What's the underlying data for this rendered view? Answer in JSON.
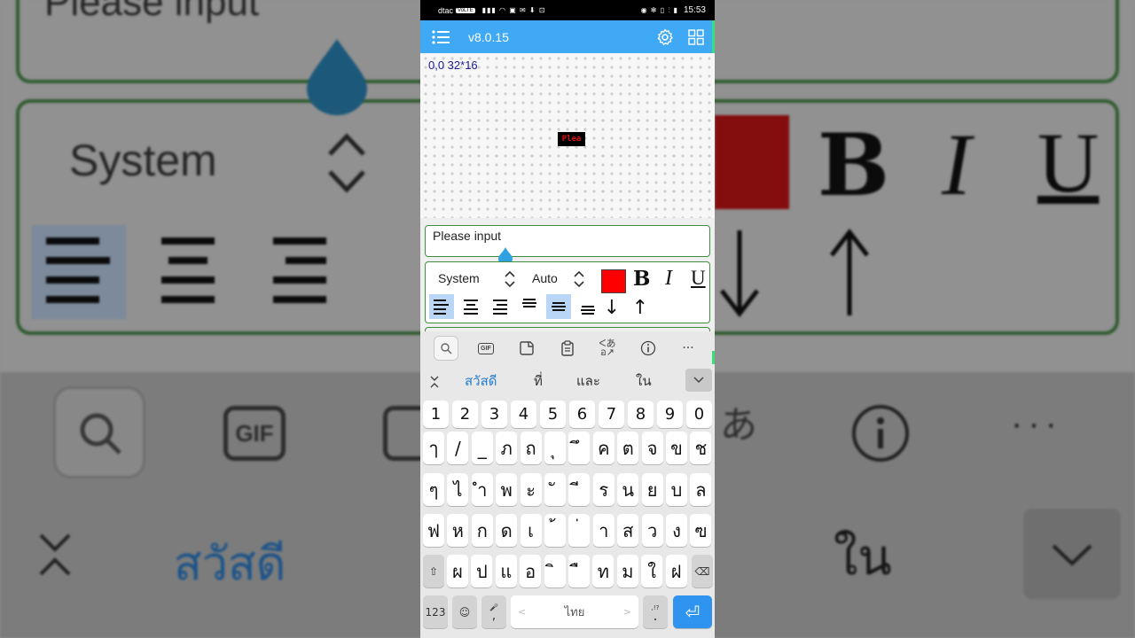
{
  "statusbar": {
    "carrier": "dtac",
    "carrier_badge": "VoLTE",
    "icons_left": "▮▮▮ ◠ ▣ ✉ ⬇ ⊡",
    "icons_right": "◉ ✻ ▯ ⫶ ▮",
    "time": "15:53"
  },
  "appbar": {
    "version": "v8.0.15",
    "menu_icon": "list-menu-icon",
    "settings_icon": "gear-icon",
    "grid_icon": "grid-icon"
  },
  "canvas": {
    "coord_label": "0,0 32*16",
    "preview_text": "Plea",
    "preview_color": "#e01010"
  },
  "editor": {
    "text_value": "Please input"
  },
  "format": {
    "font_family": "System",
    "font_size": "Auto",
    "text_color": "#ff0000",
    "bold_label": "B",
    "italic_label": "I",
    "underline_label": "U",
    "h_align_selected": "left",
    "v_align_selected": "middle",
    "down_arrow": "↓",
    "up_arrow": "↑"
  },
  "keyboard": {
    "toolbar_icons": [
      "search-icon",
      "gif-icon",
      "sticker-icon",
      "clipboard-icon",
      "translate-icon",
      "info-icon",
      "more-icon"
    ],
    "gif_label": "GIF",
    "more_label": "···",
    "suggestions": [
      "สวัสดี",
      "ที่",
      "และ",
      "ใน"
    ],
    "row_numbers": [
      "1",
      "2",
      "3",
      "4",
      "5",
      "6",
      "7",
      "8",
      "9",
      "0"
    ],
    "row1": [
      "ๅ",
      "/",
      "_",
      "ภ",
      "ถ",
      "ุ",
      "ึ",
      "ค",
      "ต",
      "จ",
      "ข",
      "ช"
    ],
    "row2": [
      "ๆ",
      "ไ",
      "ำ",
      "พ",
      "ะ",
      "ั",
      "ี",
      "ร",
      "น",
      "ย",
      "บ",
      "ล"
    ],
    "row3": [
      "ฟ",
      "ห",
      "ก",
      "ด",
      "เ",
      "้",
      "่",
      "า",
      "ส",
      "ว",
      "ง",
      "ฃ"
    ],
    "row4": [
      "ผ",
      "ป",
      "แ",
      "อ",
      "ิ",
      "ื",
      "ท",
      "ม",
      "ใ",
      "ฝ"
    ],
    "shift_label": "⇧",
    "backspace_label": "⌫",
    "numbers_label": "123",
    "emoji_label": "☺",
    "mic_label": "🎤",
    "comma_label": ",",
    "space_label": "ไทย",
    "space_left_hint": "<",
    "space_right_hint": ">",
    "period_label": ".",
    "period_hint": ",!?",
    "enter_label": "⏎"
  },
  "background": {
    "input_text": "Please input",
    "font_text": "System",
    "suggestion_text": "สวัสดี",
    "suggestion_text2": "ใน",
    "gif_label": "GIF",
    "bold_label": "B",
    "italic_label": "I",
    "underline_label": "U"
  }
}
